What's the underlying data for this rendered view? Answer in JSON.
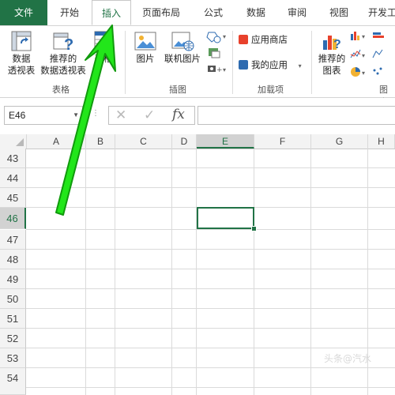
{
  "tabs": [
    "文件",
    "开始",
    "插入",
    "页面布局",
    "公式",
    "数据",
    "审阅",
    "视图",
    "开发工"
  ],
  "active_tab": "插入",
  "ribbon": {
    "pivot_table": [
      "数据",
      "透视表"
    ],
    "recommended_pivot": [
      "推荐的",
      "数据透视表"
    ],
    "table_partial": "表格",
    "group_tables": "表格",
    "picture": "图片",
    "online_picture": "联机图片",
    "group_illustrations": "插图",
    "app_store": "应用商店",
    "my_apps": "我的应用",
    "group_addins": "加载项",
    "recommended_charts": [
      "推荐的",
      "图表"
    ],
    "group_charts": "图表"
  },
  "formula_bar": {
    "name_box": "E46",
    "cancel": "✕",
    "enter": "✓",
    "fx": "fx",
    "formula": ""
  },
  "columns": [
    "A",
    "B",
    "C",
    "D",
    "E",
    "F",
    "G",
    "H"
  ],
  "selected_column": "E",
  "rows": [
    "43",
    "44",
    "45",
    "46",
    "47",
    "48",
    "49",
    "50",
    "51",
    "52",
    "53",
    "54"
  ],
  "selected_row": "46",
  "colors": {
    "accent": "#217346",
    "arrow": "#22e61a"
  },
  "watermark": "头条@汽水"
}
